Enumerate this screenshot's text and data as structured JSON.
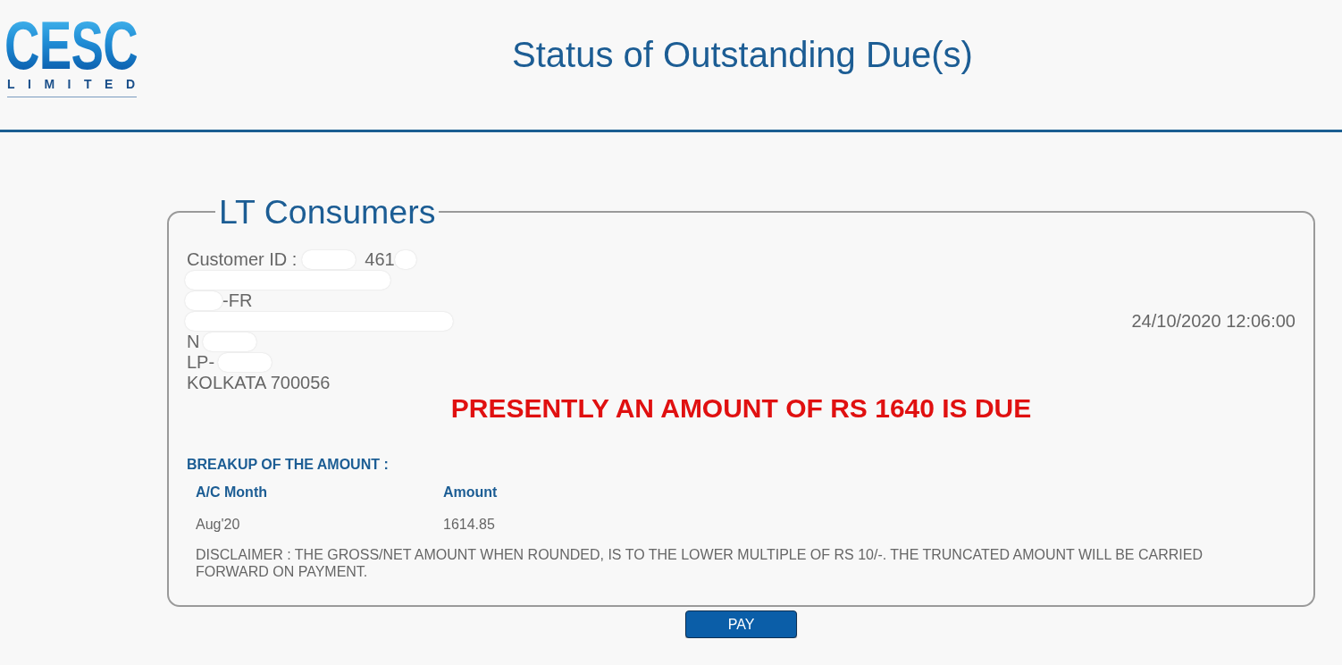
{
  "logo": {
    "name": "CESC",
    "subtitle": "LIMITED"
  },
  "header": {
    "title": "Status of Outstanding Due(s)"
  },
  "panel": {
    "legend": "LT Consumers",
    "customer_id": {
      "label": "Customer ID :",
      "value": "461",
      "masked": true
    },
    "address_lines": [
      {
        "kind": "masked"
      },
      {
        "kind": "masked-start",
        "text": "-FR"
      },
      {
        "kind": "masked"
      },
      {
        "kind": "masked-end",
        "text": "N"
      },
      {
        "kind": "masked-end",
        "text": "LP-"
      },
      {
        "kind": "plain",
        "text": "KOLKATA 700056"
      }
    ],
    "timestamp": "24/10/2020 12:06:00",
    "due_notice": "PRESENTLY AN AMOUNT OF RS 1640 IS DUE",
    "breakup": {
      "heading": "BREAKUP OF THE AMOUNT :",
      "columns": [
        "A/C Month",
        "Amount"
      ],
      "rows": [
        [
          "Aug'20",
          "1614.85"
        ]
      ]
    },
    "disclaimer": "DISCLAIMER : THE GROSS/NET AMOUNT WHEN ROUNDED, IS TO THE LOWER MULTIPLE OF RS 10/-. THE TRUNCATED AMOUNT WILL BE CARRIED FORWARD ON PAYMENT."
  },
  "buttons": [
    {
      "label": "PAY"
    }
  ]
}
